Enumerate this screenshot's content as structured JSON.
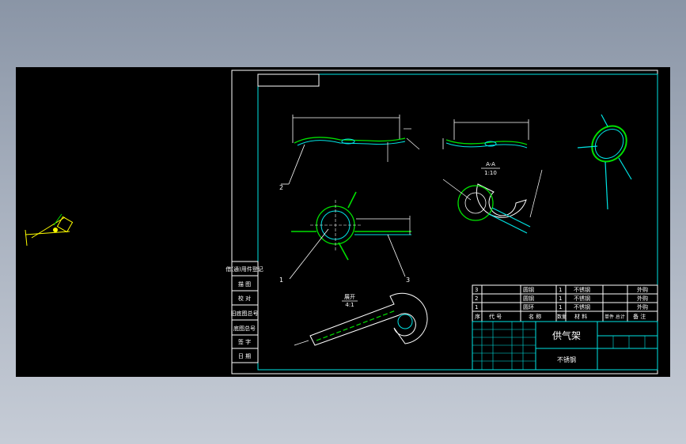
{
  "colors": {
    "background": "#000000",
    "border": "#ffffff",
    "frame": "#00e5e5",
    "part": "#00e000",
    "dimension": "#ffffff",
    "leader": "#ffffff",
    "highlight": "#ffff00",
    "viewport": "#8f9aab"
  },
  "drawing": {
    "title": "供气架",
    "material": "不锈钢",
    "section_label": "A-A",
    "section_scale": "1:10",
    "unfold_label": "展开",
    "unfold_scale": "4:1",
    "balloons": [
      "1",
      "2",
      "3"
    ]
  },
  "bom": {
    "rows": [
      {
        "no": "3",
        "name": "圆钢",
        "qty": "1",
        "material": "不锈钢",
        "remark": "外购"
      },
      {
        "no": "2",
        "name": "圆钢",
        "qty": "1",
        "material": "不锈钢",
        "remark": "外购"
      },
      {
        "no": "1",
        "name": "圆环",
        "qty": "1",
        "material": "不锈钢",
        "remark": "外购"
      }
    ],
    "headers": [
      "序",
      "代 号",
      "名 称",
      "数量",
      "材 料",
      "单件 总计",
      "备 注"
    ]
  },
  "side_stamps": [
    "借(通)用件登记",
    "描 图",
    "校 对",
    "旧底图总号",
    "底图总号",
    "签 字",
    "日 期"
  ]
}
